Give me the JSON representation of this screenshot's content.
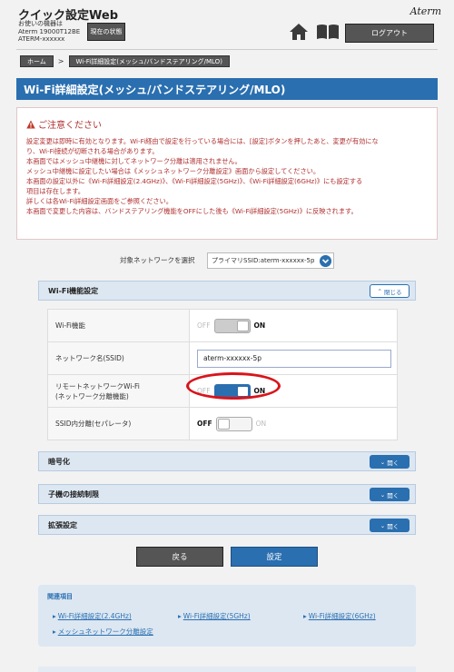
{
  "header": {
    "app_title": "クイック設定Web",
    "device_line1": "お使いの機器は",
    "device_line2": "Aterm 19000T12BE",
    "device_line3": "ATERM-xxxxxx",
    "status_label": "現在の状態",
    "brand": "Aterm",
    "logout_label": "ログアウト"
  },
  "breadcrumb": {
    "home": "ホーム",
    "separator": ">",
    "current": "Wi-Fi詳細設定(メッシュ/バンドステアリング/MLO)"
  },
  "page_title": "Wi-Fi詳細設定(メッシュ/バンドステアリング/MLO)",
  "notice": {
    "title": "ご注意ください",
    "lines": [
      "設定変更は即時に有効となります。Wi-Fi経由で設定を行っている場合には、[設定]ボタンを押したあと、変更が有効にな",
      "り、Wi-Fi接続が切断される場合があります。",
      "本画面ではメッシュ中継機に対してネットワーク分離は適用されません。",
      "メッシュ中継機に設定したい場合は《メッシュネットワーク分離設定》画面から設定してください。",
      "本画面の設定以外に《Wi-Fi詳細設定(2.4GHz)》、《Wi-Fi詳細設定(5GHz)》、《Wi-Fi詳細設定(6GHz)》にも設定する",
      "項目は存在します。",
      "詳しくは各Wi-Fi詳細設定画面をご参照ください。",
      "本画面で変更した内容は、バンドステアリング機能をOFFにした後も《Wi-Fi詳細設定(5GHz)》に反映されます。"
    ]
  },
  "network_select": {
    "label": "対象ネットワークを選択",
    "value": "プライマリSSID:aterm-xxxxxx-5p"
  },
  "sections": {
    "wifi_function": {
      "title": "Wi-Fi機能設定",
      "button": "閉じる"
    },
    "encryption": {
      "title": "暗号化",
      "button": "開く"
    },
    "client_limit": {
      "title": "子機の接続制限",
      "button": "開く"
    },
    "extended": {
      "title": "拡張設定",
      "button": "開く"
    }
  },
  "settings": {
    "wifi_function": {
      "label": "Wi-Fi機能",
      "off": "OFF",
      "on": "ON",
      "state": "on",
      "disabled": true
    },
    "ssid": {
      "label": "ネットワーク名(SSID)",
      "value": "aterm-xxxxxx-5p"
    },
    "remote_network": {
      "label_line1": "リモートネットワークWi-Fi",
      "label_line2": "(ネットワーク分離機能)",
      "off": "OFF",
      "on": "ON",
      "state": "on"
    },
    "ssid_separator": {
      "label": "SSID内分離(セパレータ)",
      "off": "OFF",
      "on": "ON",
      "state": "off"
    }
  },
  "buttons": {
    "back": "戻る",
    "save": "設定"
  },
  "related": {
    "title": "関連項目",
    "links": [
      "Wi-Fi詳細設定(2.4GHz)",
      "Wi-Fi詳細設定(5GHz)",
      "Wi-Fi詳細設定(6GHz)",
      "メッシュネットワーク分離設定"
    ]
  },
  "colors": {
    "accent": "#2a6fb0",
    "notice_text": "#b03030",
    "highlight": "#d9141b"
  }
}
